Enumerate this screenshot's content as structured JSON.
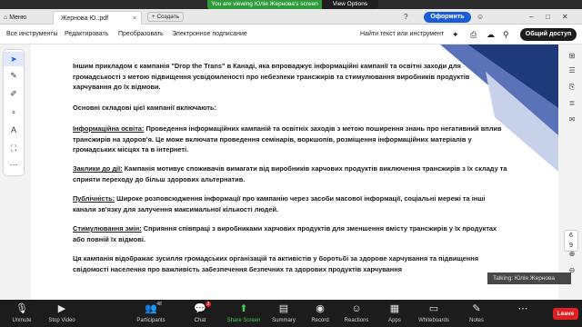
{
  "share_banner": {
    "status": "You are viewing Юлія Жернова's screen",
    "view_options": "View Options"
  },
  "viewer": {
    "tabs": {
      "menu": "Меню",
      "document": "Жернова Ю..pdf",
      "new_tab": "+ Создать"
    },
    "subscribe": "Оформить",
    "toolbar": {
      "all_tools": "Все инструменты",
      "edit": "Редактировать",
      "convert": "Преобразовать",
      "esign": "Электронное подписание",
      "search": "Найти текст или инструмент",
      "share": "Общий доступ"
    },
    "page_number": {
      "current": "6",
      "total": "9"
    },
    "document": {
      "p1": "Іншим прикладом є кампанія \"Drop the Trans\" в Канаді, яка впроваджує інформаційні кампанії та освітні заходи для громадськості з метою підвищення усвідомленості про небезпеки трансжирів та стимулювання виробників продуктів харчування до їх відмови.",
      "p2": "Основні складові цієї кампанії включають:",
      "p3_head": "Інформаційна освіта:",
      "p3": " Проведення інформаційних кампаній та освітніх заходів з метою поширення знань про негативний вплив трансжирів на здоров'я. Це може включати проведення семінарів, воркшопів, розміщення інформаційних матеріалів у громадських місцях та в інтернеті.",
      "p4_head": "Заклики до дії:",
      "p4": " Кампанія мотивує споживачів вимагати від виробників харчових продуктів виключення трансжирів з їх складу та сприяти переходу до більш здорових альтернатив.",
      "p5_head": "Публічність:",
      "p5": " Широке розповсюдження інформації про кампанію через засоби масової інформації, соціальні мережі та інші канали зв'язку для залучення максимальної кількості людей.",
      "p6_head": "Стимулювання змін:",
      "p6": " Сприяння співпраці з виробниками харчових продуктів для зменшення вмісту трансжирів у їх продуктах або повній їх відмові.",
      "p7": "Ця кампанія відображає зусилля громадських організацій та активістів у боротьбі за здорове харчування та підвищення свідомості населення про важливість забезпечення безпечних та здорових продуктів харчування"
    }
  },
  "talking": "Talking: Юлія Жернова",
  "zoom_bar": {
    "unmute": "Unmute",
    "stop_video": "Stop Video",
    "participants": "Participants",
    "participants_count": "48",
    "chat": "Chat",
    "chat_badge": "3",
    "share_screen": "Share Screen",
    "summary": "Summary",
    "record": "Record",
    "reactions": "Reactions",
    "apps": "Apps",
    "whiteboards": "Whiteboards",
    "notes": "Notes",
    "leave": "Leave"
  },
  "colors": {
    "share_green": "#2e9a3a",
    "accent_blue": "#1a5bd6",
    "leave_red": "#e02020",
    "deco_navy": "#1f3a7a"
  }
}
